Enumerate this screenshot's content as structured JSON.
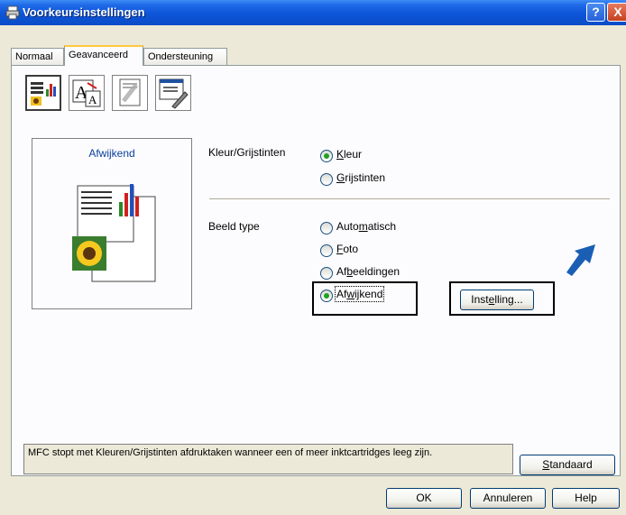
{
  "window": {
    "title": "Voorkeursinstellingen",
    "help_button": "?",
    "close_button": "X"
  },
  "tabs": [
    {
      "label": "Normaal"
    },
    {
      "label": "Geavanceerd",
      "active": true
    },
    {
      "label": "Ondersteuning"
    }
  ],
  "toolbar": {
    "icons": [
      "color-settings-icon",
      "scaling-icon",
      "watermark-copy-icon",
      "device-options-icon"
    ]
  },
  "preview": {
    "label": "Afwijkend"
  },
  "color_section": {
    "label": "Kleur/Grijstinten",
    "options": [
      {
        "pre": "",
        "u": "K",
        "post": "leur",
        "checked": true
      },
      {
        "pre": "",
        "u": "G",
        "post": "rijstinten",
        "checked": false
      }
    ]
  },
  "image_type_section": {
    "label": "Beeld type",
    "options": [
      {
        "pre": "Auto",
        "u": "m",
        "post": "atisch",
        "checked": false
      },
      {
        "pre": "",
        "u": "F",
        "post": "oto",
        "checked": false
      },
      {
        "pre": "Af",
        "u": "b",
        "post": "eeldingen",
        "checked": false
      },
      {
        "pre": "Af",
        "u": "w",
        "post": "ijkend",
        "checked": true
      }
    ],
    "settings_button": {
      "pre": "Inst",
      "u": "e",
      "post": "lling..."
    }
  },
  "status_message": "MFC stopt met Kleuren/Grijstinten afdruktaken wanneer een of meer inktcartridges leeg zijn.",
  "buttons": {
    "default": {
      "pre": "",
      "u": "S",
      "post": "tandaard"
    },
    "ok": "OK",
    "cancel": "Annuleren",
    "help": "Help"
  },
  "colors": {
    "titlebar": "#0a4cc6",
    "dialog_bg": "#ece9d8",
    "radio_dot": "#21a121",
    "preview_label": "#0b3e9b",
    "arrow": "#1a5fb4"
  }
}
